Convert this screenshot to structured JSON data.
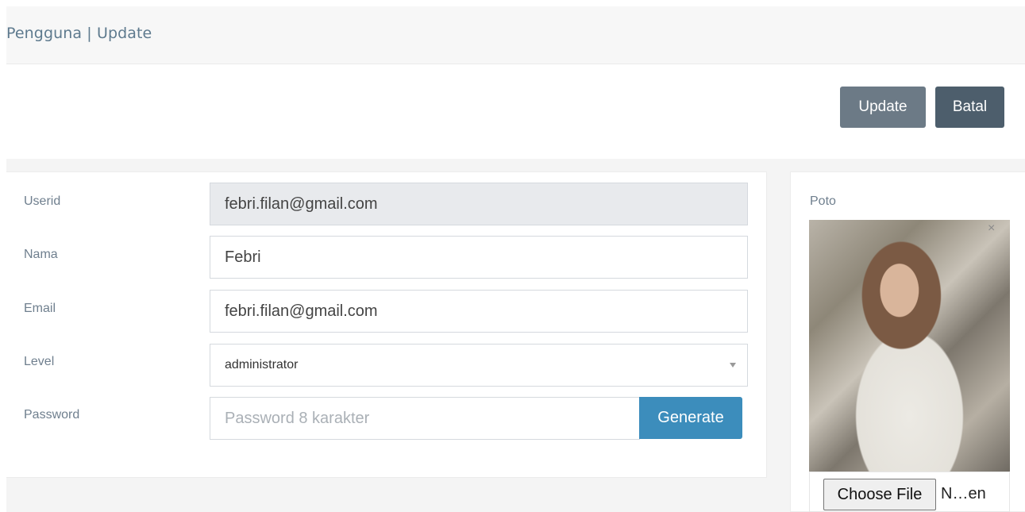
{
  "header": {
    "title": "Pengguna | Update"
  },
  "toolbar": {
    "update_label": "Update",
    "cancel_label": "Batal"
  },
  "form": {
    "userid": {
      "label": "Userid",
      "value": "febri.filan@gmail.com"
    },
    "nama": {
      "label": "Nama",
      "value": "Febri"
    },
    "email": {
      "label": "Email",
      "value": "febri.filan@gmail.com"
    },
    "level": {
      "label": "Level",
      "value": "administrator"
    },
    "password": {
      "label": "Password",
      "placeholder": "Password 8 karakter",
      "generate_label": "Generate"
    }
  },
  "photo": {
    "label": "Poto",
    "close_symbol": "×",
    "choose_label": "Choose File",
    "file_name": "N…en"
  },
  "colors": {
    "primary": "#3c8dbc",
    "title": "#5e7a8e",
    "button_gray": "#6c7a86",
    "button_dark": "#4d5e6c"
  }
}
